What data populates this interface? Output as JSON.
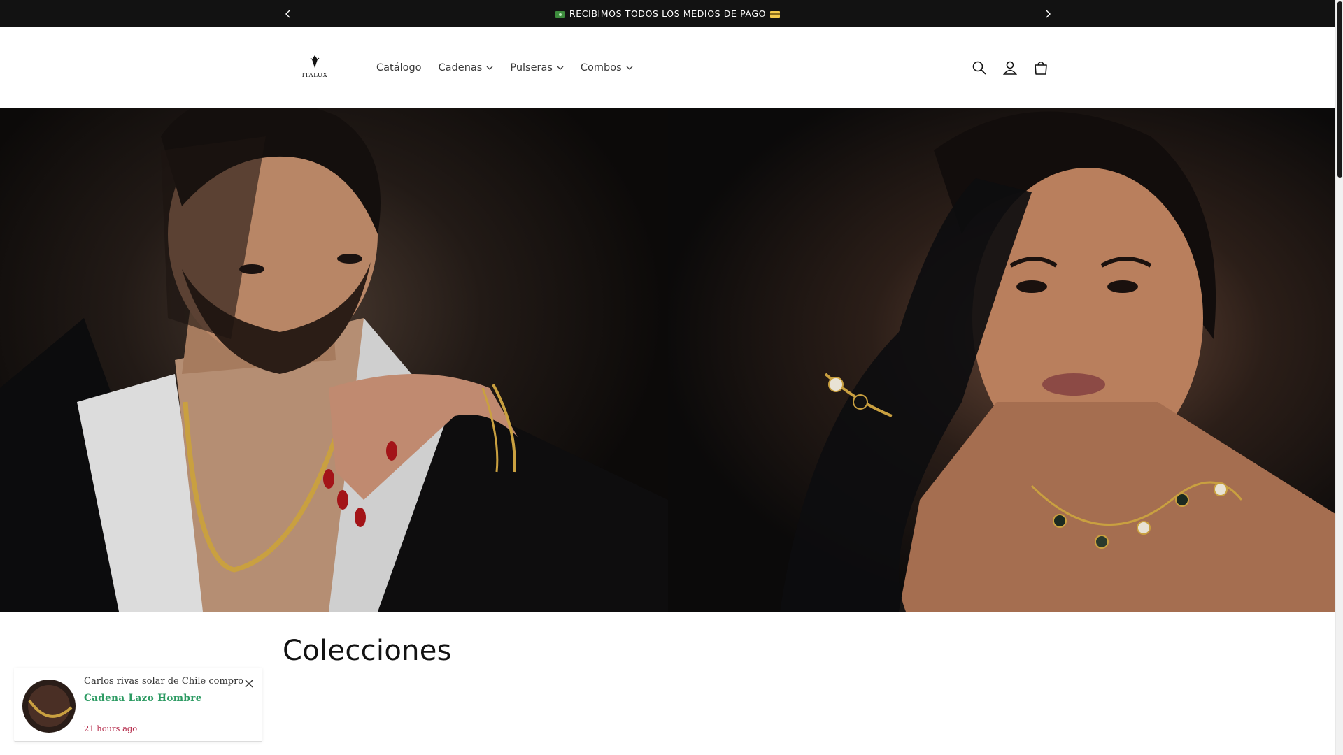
{
  "announcement": {
    "text": "RECIBIMOS TODOS LOS MEDIOS DE PAGO",
    "leading_icon": "money-emoji-icon",
    "trailing_icon": "card-emoji-icon",
    "prev_icon": "chevron-left-icon",
    "next_icon": "chevron-right-icon"
  },
  "header": {
    "logo_text": "ITALUX",
    "nav": [
      {
        "label": "Catálogo",
        "has_dropdown": false
      },
      {
        "label": "Cadenas",
        "has_dropdown": true
      },
      {
        "label": "Pulseras",
        "has_dropdown": true
      },
      {
        "label": "Combos",
        "has_dropdown": true
      }
    ],
    "icons": [
      "search-icon",
      "account-icon",
      "cart-icon"
    ]
  },
  "hero": {
    "panels": [
      "man-wearing-gold-chain-image",
      "woman-wearing-clover-necklace-image"
    ]
  },
  "collections": {
    "title": "Colecciones"
  },
  "sales_popup": {
    "message": "Carlos rivas solar de Chile compro",
    "product": "Cadena Lazo Hombre",
    "time": "21 hours ago",
    "close_icon": "close-icon"
  },
  "colors": {
    "announcement_bg": "#121212",
    "product_green": "#2d9b63",
    "time_red": "#b52a4a"
  }
}
